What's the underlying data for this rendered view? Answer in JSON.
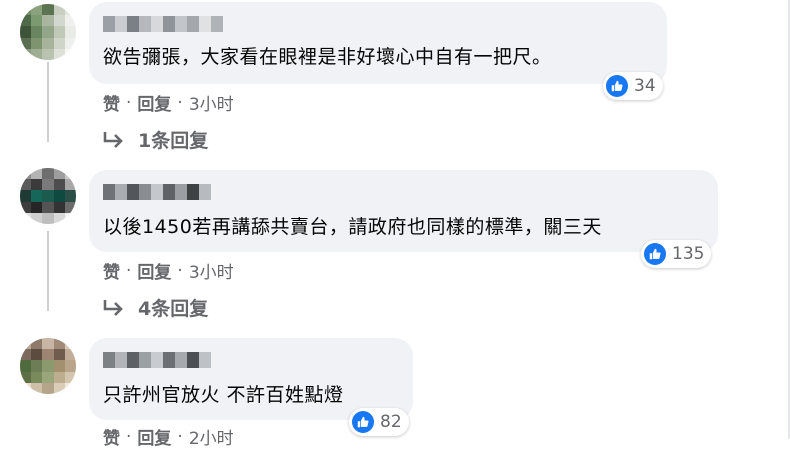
{
  "comments": [
    {
      "text": "欲告彌張，大家看在眼裡是非好壞心中自有一把尺。",
      "reactions": "34",
      "like_label": "赞",
      "reply_label": "回复",
      "time": "3小时",
      "replies_label": "1条回复",
      "avatar_colors": [
        "#6f8c62",
        "#8aa37e",
        "#5b7350",
        "#c8cfc0",
        "#e2e5df",
        "#4f6a49",
        "#7c9a70",
        "#aab69f",
        "#d3d8ce",
        "#f0f1ee",
        "#3e5439",
        "#6a8660",
        "#93a689",
        "#c0c8b7",
        "#e9ebe6",
        "#5a6f52",
        "#7e946f",
        "#a7b39b",
        "#cfd5c8",
        "#eef0ec",
        "#8b9c80",
        "#9fae95",
        "#b9c3b0",
        "#dde1d8",
        "#f6f7f5"
      ],
      "name_colors": [
        "#9aa0a6",
        "#c9ccd1",
        "#7b8086",
        "#b5b9be",
        "#d6d8db",
        "#8f949a",
        "#c2c5c9",
        "#a4a8ad",
        "#dfe1e3",
        "#b0b4b9"
      ]
    },
    {
      "text": "以後1450若再講舔共賣台，請政府也同樣的標準，關三天",
      "reactions": "135",
      "like_label": "赞",
      "reply_label": "回复",
      "time": "3小时",
      "replies_label": "4条回复",
      "avatar_colors": [
        "#8c8c8c",
        "#b3b3b3",
        "#6e6e6e",
        "#9e9e9e",
        "#c7c7c7",
        "#5a5a5a",
        "#3b3b3b",
        "#7a7a7a",
        "#4d4d4d",
        "#a8a8a8",
        "#1f3a34",
        "#17665a",
        "#1c5c4f",
        "#0f4a40",
        "#2b4f47",
        "#3d3d3d",
        "#262626",
        "#545454",
        "#333333",
        "#6b6b6b",
        "#e0e0e0",
        "#cfcfcf",
        "#bdbdbd",
        "#d9d9d9",
        "#f2f2f2"
      ],
      "name_colors": [
        "#6f7377",
        "#a9adb2",
        "#53575b",
        "#8a8e93",
        "#c4c7cb",
        "#5f6367",
        "#9b9fa4",
        "#3f4346",
        "#b7bbbf"
      ]
    },
    {
      "text": "只許州官放火 不許百姓點燈",
      "reactions": "82",
      "like_label": "赞",
      "reply_label": "回复",
      "time": "2小时",
      "avatar_colors": [
        "#b9a89a",
        "#8e7a6b",
        "#c8b5a4",
        "#a08b79",
        "#d8c9bb",
        "#7d6b5d",
        "#5c4b3f",
        "#9c8673",
        "#6f5c4e",
        "#c2ad99",
        "#4f6a3c",
        "#6d7d55",
        "#8a9a6c",
        "#a3906f",
        "#b8a58b",
        "#5e6e45",
        "#7a8b5b",
        "#99a679",
        "#bcae8f",
        "#d2c6ad",
        "#e6dccb",
        "#cdbfa8",
        "#b3a48a",
        "#d9cdb8",
        "#efe8dc"
      ],
      "name_colors": [
        "#7c8186",
        "#b1b5ba",
        "#5d6166",
        "#9ba0a5",
        "#c8cbcf",
        "#6c7075",
        "#a6aaaf",
        "#4c5055",
        "#bec2c6"
      ]
    }
  ],
  "colors": {
    "like_blue": "#1877f2",
    "bubble_bg": "#f0f2f5",
    "meta_gray": "#65676b"
  }
}
